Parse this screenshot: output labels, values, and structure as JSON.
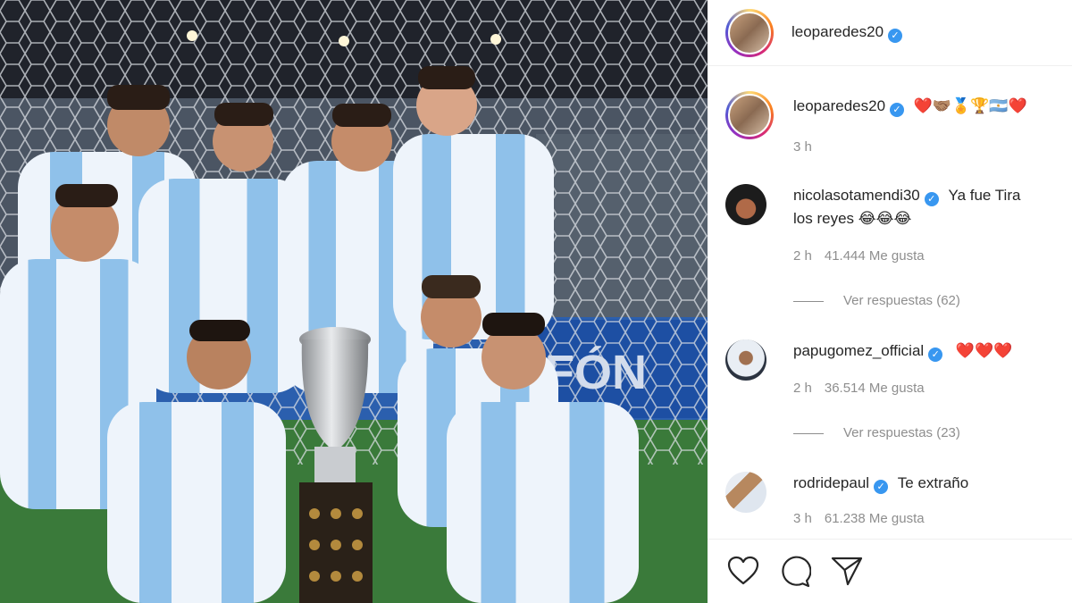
{
  "post": {
    "author": "leoparedes20",
    "verified": true
  },
  "caption": {
    "username": "leoparedes20",
    "emojis": "❤️🤝🏽🏅🏆🇦🇷❤️",
    "time": "3 h"
  },
  "comments": [
    {
      "username": "nicolasotamendi30",
      "text_line1": "Ya fue Tira",
      "text_line2": "los reyes 😂😂😂",
      "time": "2 h",
      "likes": "41.444 Me gusta",
      "replies": "Ver respuestas (62)"
    },
    {
      "username": "papugomez_official",
      "text": "❤️❤️❤️",
      "time": "2 h",
      "likes": "36.514 Me gusta",
      "replies": "Ver respuestas (23)"
    },
    {
      "username": "rodridepaul",
      "text": "Te extraño",
      "time": "3 h",
      "likes": "61.238 Me gusta"
    }
  ],
  "actions": {
    "like": "heart-icon",
    "comment": "comment-icon",
    "share": "share-icon"
  },
  "colors": {
    "verified": "#3897f0",
    "muted_text": "#8e8e8e",
    "divider": "#efefef",
    "heart": "#ed1c24"
  }
}
